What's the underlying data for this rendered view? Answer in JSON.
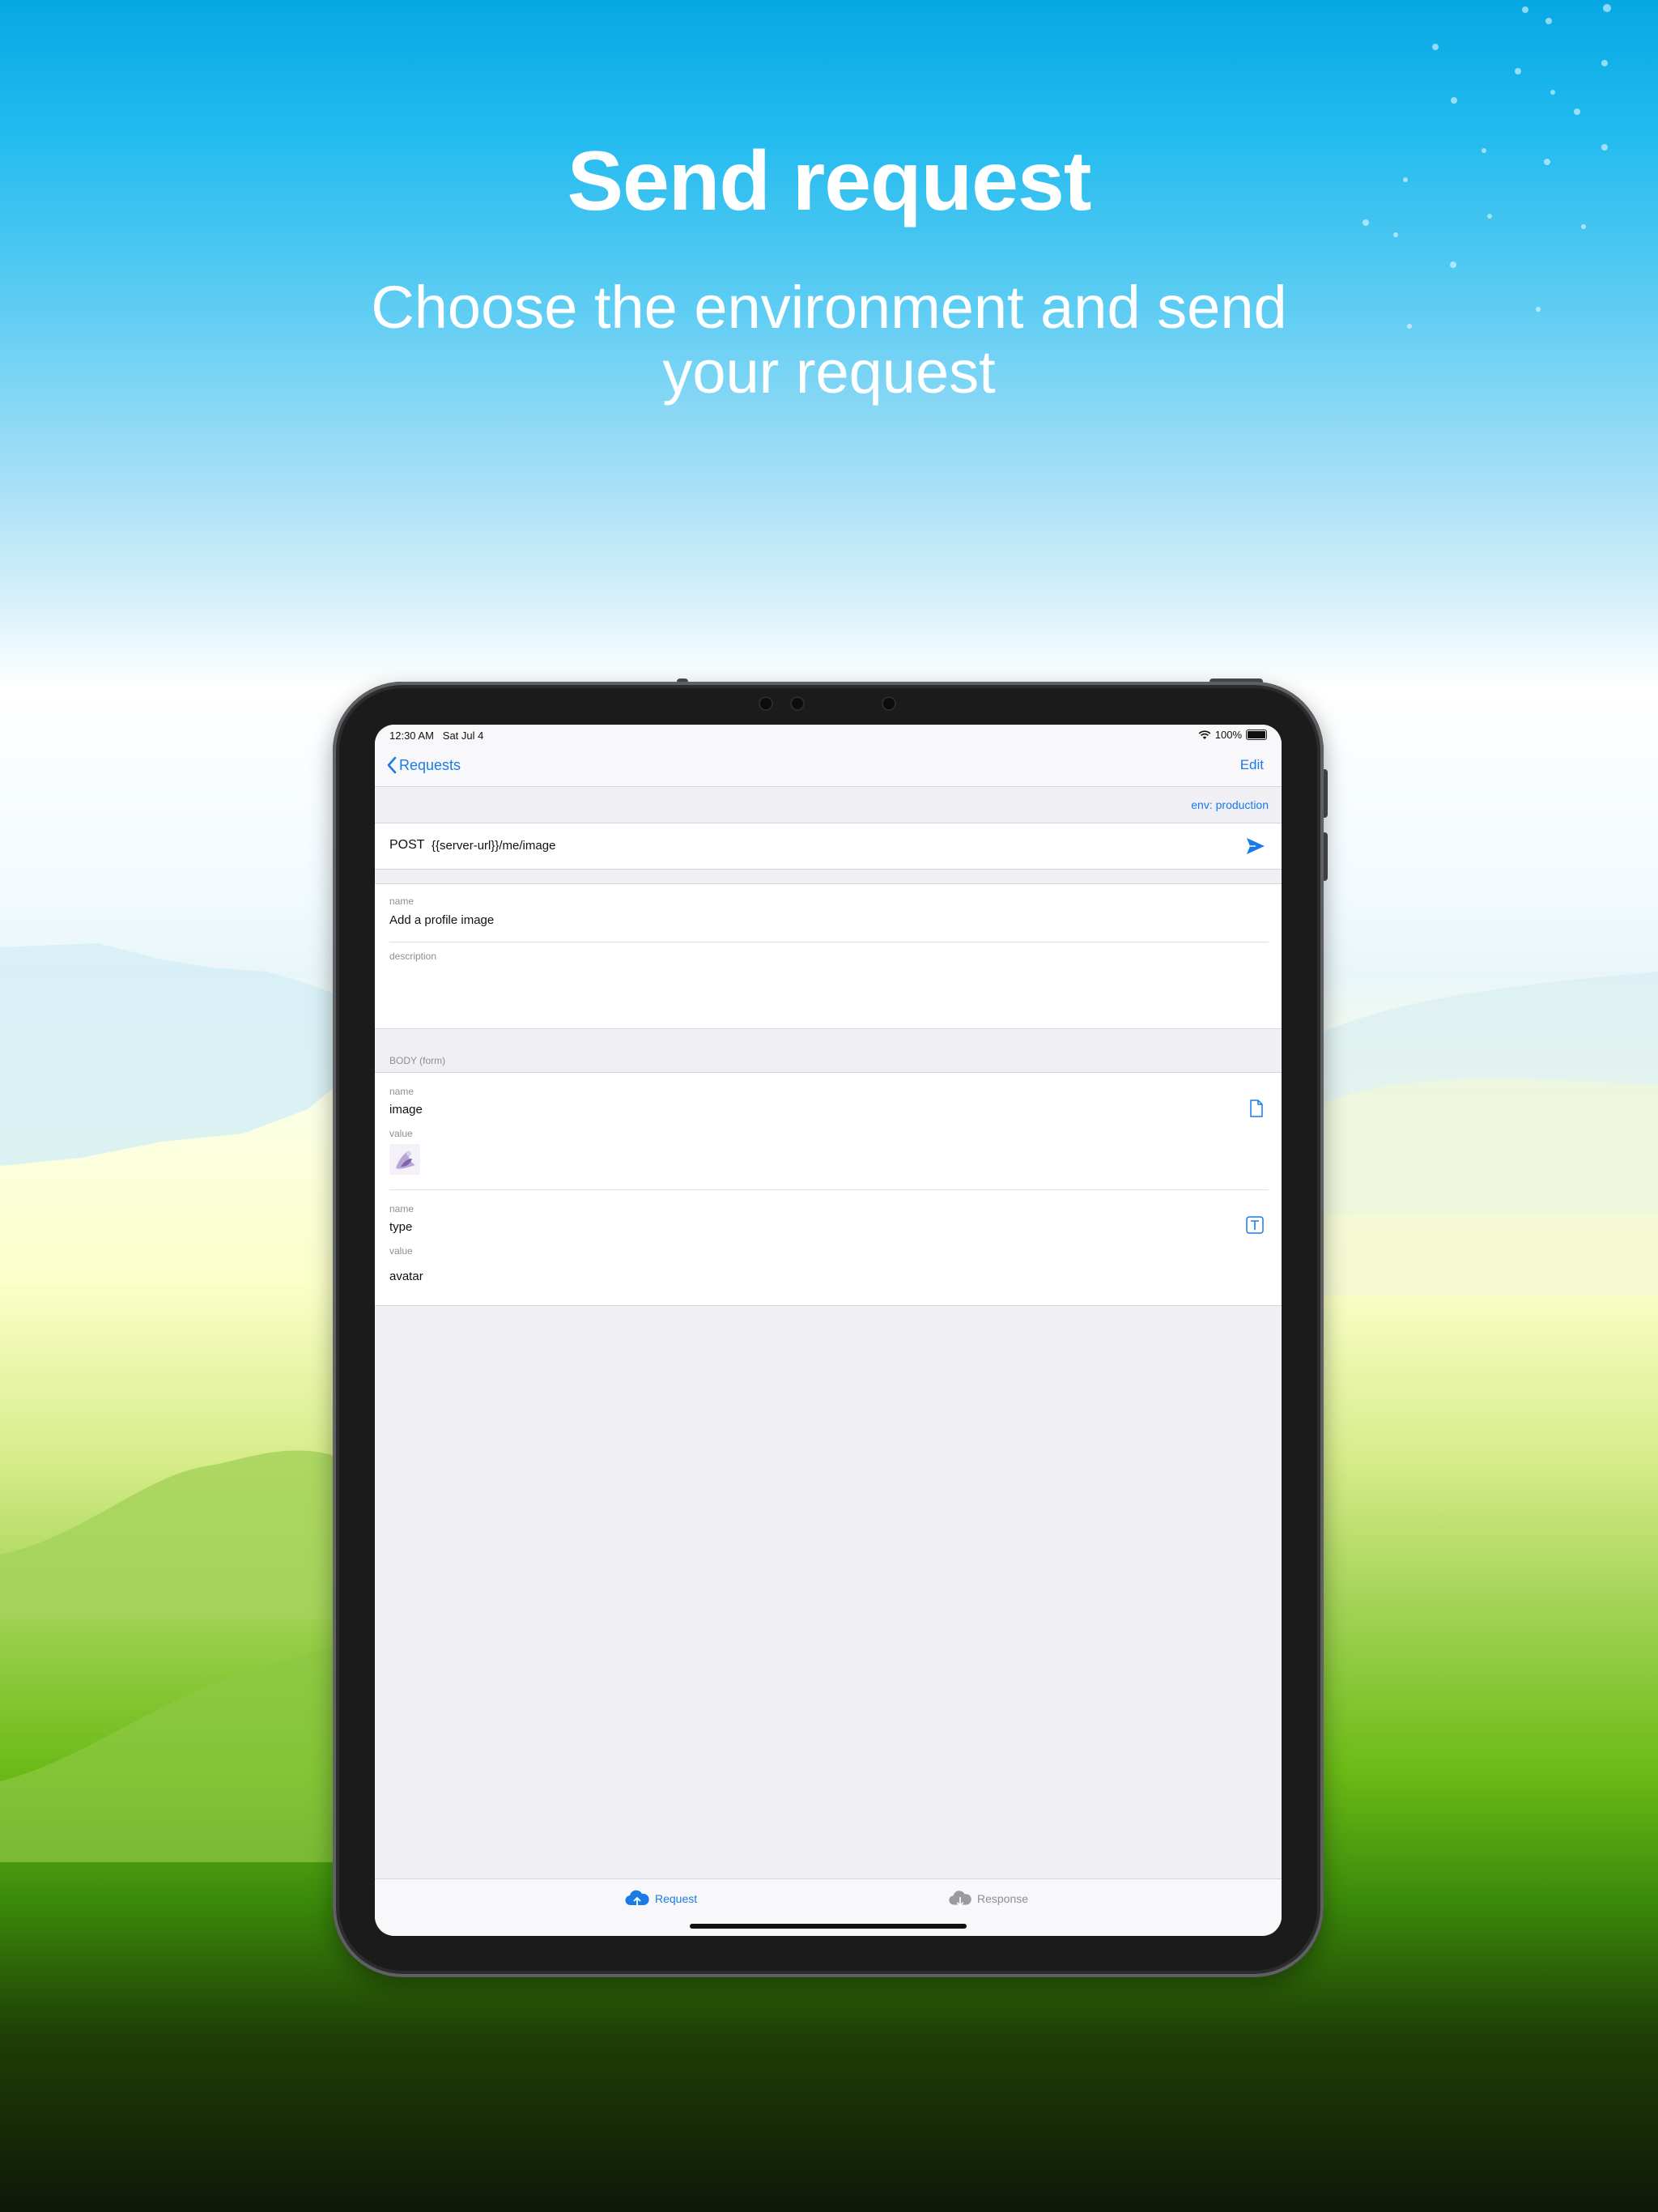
{
  "marketing": {
    "headline": "Send request",
    "subline": "Choose the environment and send your request"
  },
  "status_bar": {
    "time": "12:30 AM",
    "date": "Sat Jul 4",
    "battery": "100%"
  },
  "nav": {
    "back_label": "Requests",
    "edit_label": "Edit"
  },
  "environment": {
    "label": "env: production"
  },
  "request": {
    "method": "POST",
    "url": "{{server-url}}/me/image"
  },
  "details": {
    "name_label": "name",
    "name_value": "Add a profile image",
    "description_label": "description",
    "description_value": ""
  },
  "body": {
    "section_title": "BODY (form)",
    "fields": [
      {
        "name_label": "name",
        "name": "image",
        "value_label": "value",
        "value": "",
        "kind": "file"
      },
      {
        "name_label": "name",
        "name": "type",
        "value_label": "value",
        "value": "avatar",
        "kind": "text"
      }
    ]
  },
  "tabs": [
    {
      "label": "Request",
      "active": true
    },
    {
      "label": "Response",
      "active": false
    }
  ],
  "colors": {
    "accent": "#1a7ae6",
    "inactive": "#8e8e93"
  }
}
